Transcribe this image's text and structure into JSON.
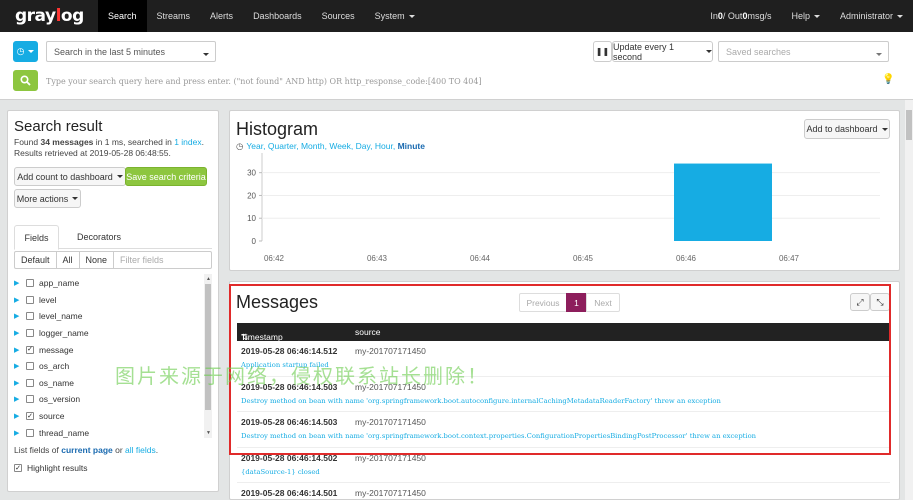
{
  "nav": {
    "logo": "graylog",
    "items": [
      {
        "label": "Search",
        "active": true
      },
      {
        "label": "Streams"
      },
      {
        "label": "Alerts"
      },
      {
        "label": "Dashboards"
      },
      {
        "label": "Sources"
      },
      {
        "label": "System"
      }
    ],
    "throughput": {
      "prefix": "In ",
      "in": "0",
      "sep": " / Out ",
      "out": "0",
      "suffix": " msg/s"
    },
    "help": "Help",
    "user": "Administrator"
  },
  "search": {
    "range": "Search in the last 5 minutes",
    "refresh": "Update every 1 second",
    "saved_placeholder": "Saved searches",
    "query_placeholder": "Type your search query here and press enter. (\"not found\" AND http) OR http_response_code:[400 TO 404]"
  },
  "sidebar": {
    "title": "Search result",
    "found_prefix": "Found ",
    "found_count": "34 messages",
    "found_mid": " in 1 ms, searched in ",
    "index_link": "1 index",
    "found_end": ".",
    "retrieved": "Results retrieved at 2019-05-28 06:48:55.",
    "add_count": "Add count to dashboard",
    "save_criteria": "Save search criteria",
    "more_actions": "More actions",
    "tabs": [
      "Fields",
      "Decorators"
    ],
    "filters": [
      "Default",
      "All",
      "None"
    ],
    "filter_placeholder": "Filter fields",
    "fields": [
      {
        "name": "app_name",
        "checked": false
      },
      {
        "name": "level",
        "checked": false
      },
      {
        "name": "level_name",
        "checked": false
      },
      {
        "name": "logger_name",
        "checked": false
      },
      {
        "name": "message",
        "checked": true
      },
      {
        "name": "os_arch",
        "checked": false
      },
      {
        "name": "os_name",
        "checked": false
      },
      {
        "name": "os_version",
        "checked": false
      },
      {
        "name": "source",
        "checked": true
      },
      {
        "name": "thread_name",
        "checked": false
      }
    ],
    "footer_prefix": "List fields of ",
    "footer_current": "current page",
    "footer_or": " or ",
    "footer_all": "all fields",
    "footer_end": ".",
    "highlight": "Highlight results"
  },
  "histogram": {
    "title": "Histogram",
    "add_dashboard": "Add to dashboard",
    "resolutions": [
      "Year",
      "Quarter",
      "Month",
      "Week",
      "Day",
      "Hour",
      "Minute"
    ],
    "current_resolution": "Minute"
  },
  "chart_data": {
    "type": "bar",
    "categories": [
      "06:42",
      "06:43",
      "06:44",
      "06:45",
      "06:46",
      "06:47"
    ],
    "values": [
      0,
      0,
      0,
      0,
      34,
      0
    ],
    "ylim": [
      0,
      36
    ],
    "yticks": [
      "0",
      "10",
      "20",
      "30"
    ],
    "title": "Histogram",
    "bar_color": "#16ace3"
  },
  "messages": {
    "title": "Messages",
    "pager": {
      "previous": "Previous",
      "current": "1",
      "next": "Next"
    },
    "columns": {
      "timestamp": "Timestamp",
      "source": "source"
    },
    "rows": [
      {
        "timestamp": "2019-05-28 06:46:14.512",
        "source": "my-201707171450",
        "message": "Application startup failed"
      },
      {
        "timestamp": "2019-05-28 06:46:14.503",
        "source": "my-201707171450",
        "message": "Destroy method on bean with name 'org.springframework.boot.autoconfigure.internalCachingMetadataReaderFactory' threw an exception"
      },
      {
        "timestamp": "2019-05-28 06:46:14.503",
        "source": "my-201707171450",
        "message": "Destroy method on bean with name 'org.springframework.boot.context.properties.ConfigurationPropertiesBindingPostProcessor' threw an exception"
      },
      {
        "timestamp": "2019-05-28 06:46:14.502",
        "source": "my-201707171450",
        "message": "{dataSource-1} closed"
      },
      {
        "timestamp": "2019-05-28 06:46:14.501",
        "source": "my-201707171450",
        "message": ""
      }
    ]
  },
  "watermark": "图片来源于网络，侵权联系站长删除！"
}
